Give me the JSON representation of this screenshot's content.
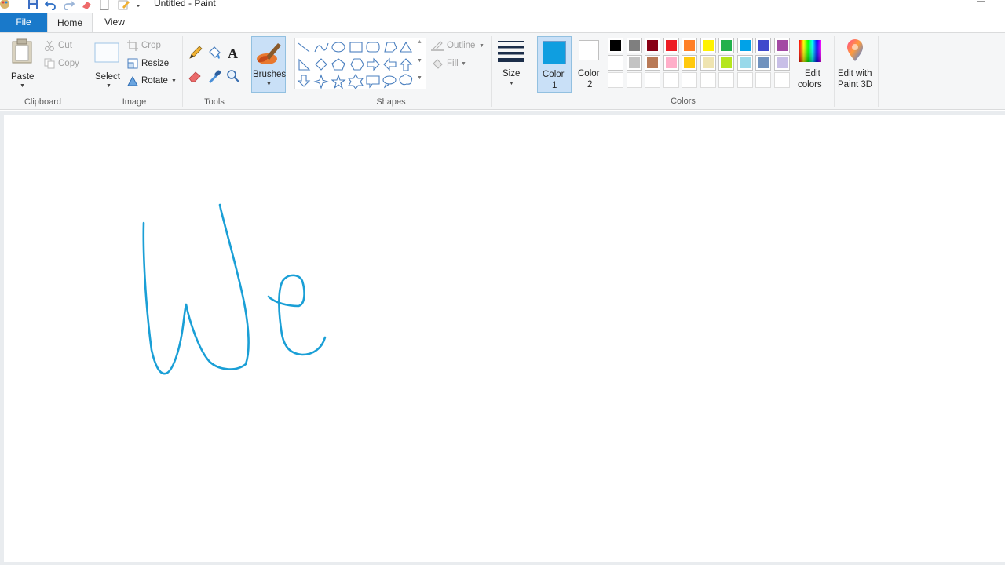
{
  "window": {
    "title": "Untitled - Paint"
  },
  "quick_access": {
    "icons": [
      "paint-app-icon",
      "save-icon",
      "undo-icon",
      "redo-icon",
      "eraser-icon",
      "new-icon",
      "pencil-icon",
      "customize-dropdown-icon"
    ]
  },
  "tabs": [
    {
      "label": "File"
    },
    {
      "label": "Home"
    },
    {
      "label": "View"
    }
  ],
  "clipboard": {
    "paste": "Paste",
    "cut": "Cut",
    "copy": "Copy",
    "group": "Clipboard"
  },
  "image": {
    "select": "Select",
    "crop": "Crop",
    "resize": "Resize",
    "rotate": "Rotate",
    "group": "Image"
  },
  "tools": {
    "group": "Tools"
  },
  "brushes": {
    "label": "Brushes"
  },
  "shapes": {
    "outline": "Outline",
    "fill": "Fill",
    "group": "Shapes"
  },
  "size": {
    "label": "Size"
  },
  "colors": {
    "color1_line1": "Color",
    "color1_line2": "1",
    "color2_line1": "Color",
    "color2_line2": "2",
    "edit_line1": "Edit",
    "edit_line2": "colors",
    "paint3d_line1": "Edit with",
    "paint3d_line2": "Paint 3D",
    "group": "Colors",
    "color1_value": "#0f9ee0",
    "color2_value": "#ffffff",
    "palette_row1": [
      "#000000",
      "#7f7f7f",
      "#880015",
      "#ed1c24",
      "#ff7f27",
      "#fff200",
      "#22b14c",
      "#00a2e8",
      "#3f48cc",
      "#a349a4"
    ],
    "palette_row2": [
      "#ffffff",
      "#c3c3c3",
      "#b97a57",
      "#ffaec9",
      "#ffc90e",
      "#efe4b0",
      "#b5e61d",
      "#99d9ea",
      "#7092be",
      "#c8bfe7"
    ]
  },
  "canvas": {
    "stroke_color": "#1a9fd6",
    "drawn_text": "We"
  }
}
